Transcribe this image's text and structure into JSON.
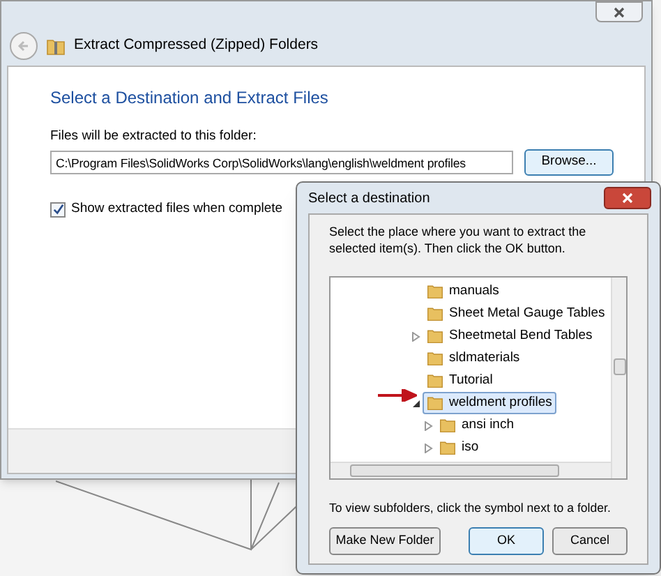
{
  "window": {
    "title": "Extract Compressed (Zipped) Folders"
  },
  "heading": "Select a Destination and Extract Files",
  "path_label": "Files will be extracted to this folder:",
  "path_field": {
    "value": "C:\\Program Files\\SolidWorks Corp\\SolidWorks\\lang\\english\\weldment profiles"
  },
  "browse_button": "Browse...",
  "show_files": {
    "label": "Show extracted files when complete",
    "checked": true
  },
  "dialog": {
    "title": "Select a destination",
    "instructions": "Select the place where you want to extract the selected item(s).  Then click the OK button.",
    "tree": [
      {
        "label": "manuals",
        "kind": "leaf",
        "selected": false
      },
      {
        "label": "Sheet Metal Gauge Tables",
        "kind": "leaf",
        "selected": false
      },
      {
        "label": "Sheetmetal Bend Tables",
        "kind": "branch",
        "expanded": false,
        "selected": false
      },
      {
        "label": "sldmaterials",
        "kind": "leaf",
        "selected": false
      },
      {
        "label": "Tutorial",
        "kind": "leaf",
        "selected": false
      },
      {
        "label": "weldment profiles",
        "kind": "branch",
        "expanded": true,
        "selected": true,
        "children": [
          {
            "label": "ansi inch",
            "kind": "branch",
            "expanded": false,
            "selected": false
          },
          {
            "label": "iso",
            "kind": "branch",
            "expanded": false,
            "selected": false
          }
        ]
      }
    ],
    "hint": "To view subfolders, click the symbol next to a folder.",
    "buttons": [
      {
        "label": "Make New Folder",
        "default": false
      },
      {
        "label": "OK",
        "default": true
      },
      {
        "label": "Cancel",
        "default": false
      }
    ]
  }
}
